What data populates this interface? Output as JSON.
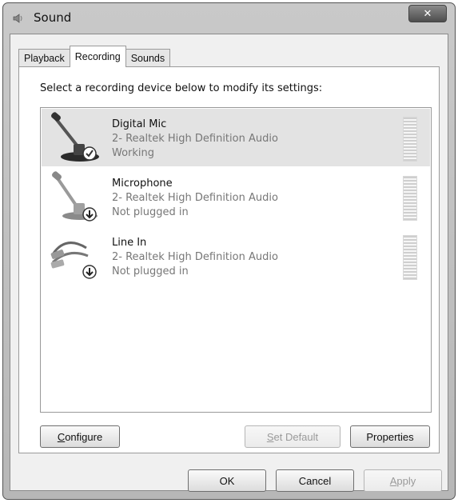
{
  "window": {
    "title": "Sound",
    "close_glyph": "✕"
  },
  "tabs": [
    {
      "label": "Playback",
      "active": false
    },
    {
      "label": "Recording",
      "active": true
    },
    {
      "label": "Sounds",
      "active": false
    }
  ],
  "recording": {
    "instruction": "Select a recording device below to modify its settings:",
    "devices": [
      {
        "name": "Digital Mic",
        "driver": "2- Realtek High Definition Audio",
        "status": "Working",
        "selected": true,
        "icon": "microphone-icon",
        "badge": "check-icon"
      },
      {
        "name": "Microphone",
        "driver": "2- Realtek High Definition Audio",
        "status": "Not plugged in",
        "selected": false,
        "icon": "microphone-icon",
        "badge": "unplugged-icon"
      },
      {
        "name": "Line In",
        "driver": "2- Realtek High Definition Audio",
        "status": "Not plugged in",
        "selected": false,
        "icon": "cable-icon",
        "badge": "unplugged-icon"
      }
    ]
  },
  "buttons": {
    "configure": {
      "mnemonic": "C",
      "rest": "onfigure"
    },
    "set_default": {
      "mnemonic": "S",
      "rest": "et Default"
    },
    "properties": {
      "label": "Properties"
    },
    "ok": {
      "label": "OK"
    },
    "cancel": {
      "label": "Cancel"
    },
    "apply": {
      "mnemonic": "A",
      "rest": "pply"
    }
  }
}
